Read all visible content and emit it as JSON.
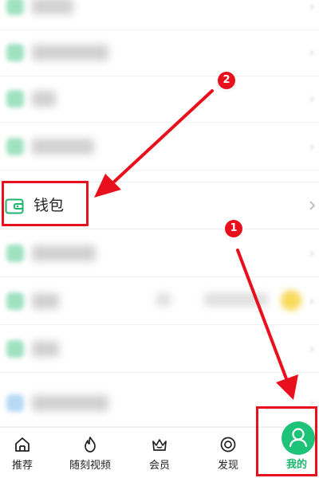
{
  "list": {
    "wallet_label": "钱包"
  },
  "annotations": {
    "step1": "1",
    "step2": "2"
  },
  "tabbar": {
    "tabs": [
      {
        "label": "推荐",
        "icon": "home-icon"
      },
      {
        "label": "随刻视频",
        "icon": "flame-icon"
      },
      {
        "label": "会员",
        "icon": "crown-icon"
      },
      {
        "label": "发现",
        "icon": "discover-icon"
      },
      {
        "label": "我的",
        "icon": "user-icon",
        "active": true
      }
    ]
  },
  "colors": {
    "accent_green": "#1ec37a",
    "annotation_red": "#e8101d"
  }
}
